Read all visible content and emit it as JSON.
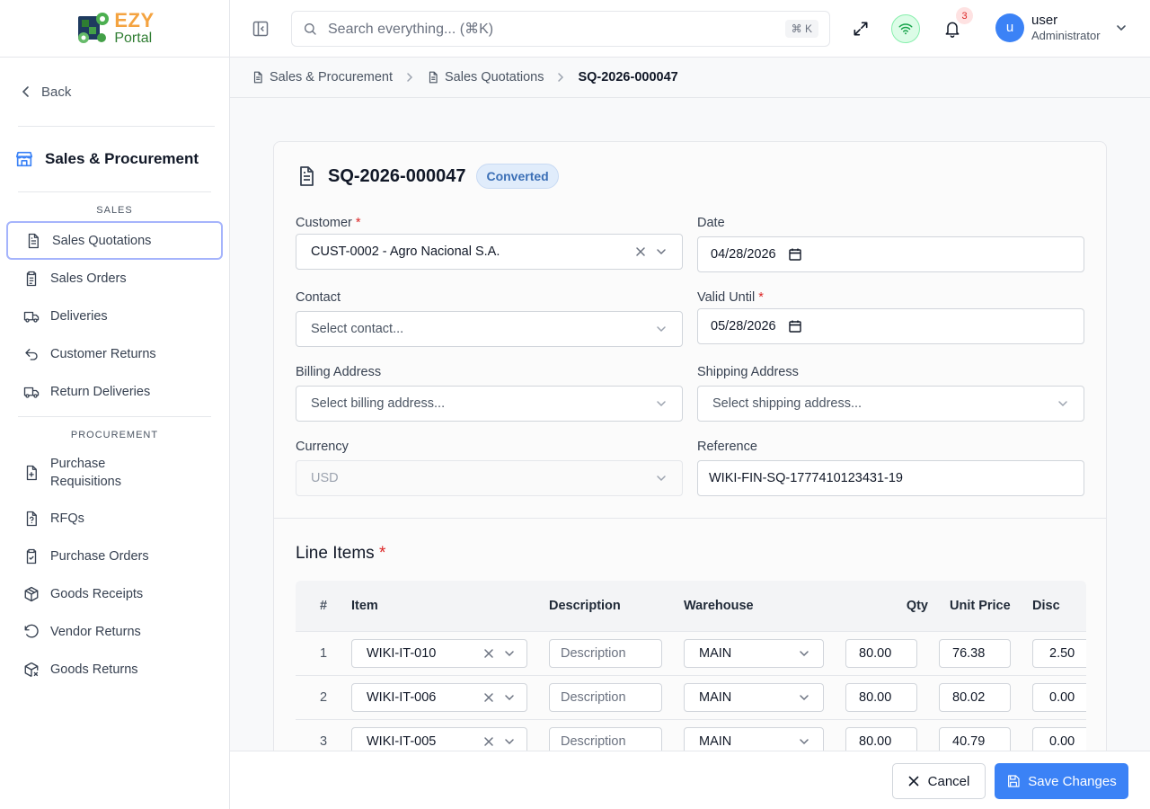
{
  "app": {
    "logo_top": "EZY",
    "logo_bottom": "Portal"
  },
  "sidebar": {
    "back_label": "Back",
    "module_title": "Sales & Procurement",
    "sales_section": "SALES",
    "procurement_section": "PROCUREMENT",
    "sales_items": [
      {
        "label": "Sales Quotations",
        "icon": "file-text-icon",
        "active": true
      },
      {
        "label": "Sales Orders",
        "icon": "clipboard-list-icon"
      },
      {
        "label": "Deliveries",
        "icon": "truck-icon"
      },
      {
        "label": "Customer Returns",
        "icon": "undo-arrow-icon"
      },
      {
        "label": "Return Deliveries",
        "icon": "truck-icon"
      }
    ],
    "procurement_items": [
      {
        "label": "Purchase Requisitions",
        "icon": "file-plus-icon"
      },
      {
        "label": "RFQs",
        "icon": "file-question-icon"
      },
      {
        "label": "Purchase Orders",
        "icon": "clipboard-check-icon"
      },
      {
        "label": "Goods Receipts",
        "icon": "package-icon"
      },
      {
        "label": "Vendor Returns",
        "icon": "rotate-ccw-icon"
      },
      {
        "label": "Goods Returns",
        "icon": "package-x-icon"
      }
    ]
  },
  "topbar": {
    "search_placeholder": "Search everything... (⌘K)",
    "search_shortcut": "⌘ K",
    "notification_count": "3",
    "user_initial": "u",
    "user_name": "user",
    "user_role": "Administrator"
  },
  "breadcrumb": {
    "items": [
      "Sales & Procurement",
      "Sales Quotations",
      "SQ-2026-000047"
    ]
  },
  "document": {
    "number": "SQ-2026-000047",
    "status": "Converted",
    "labels": {
      "customer": "Customer",
      "date": "Date",
      "contact": "Contact",
      "valid_until": "Valid Until",
      "billing_address": "Billing Address",
      "shipping_address": "Shipping Address",
      "currency": "Currency",
      "reference": "Reference",
      "required_mark": "*"
    },
    "values": {
      "customer": "CUST-0002 - Agro Nacional S.A.",
      "date": "04/28/2026",
      "contact_placeholder": "Select contact...",
      "valid_until": "05/28/2026",
      "billing_placeholder": "Select billing address...",
      "shipping_placeholder": "Select shipping address...",
      "currency": "USD",
      "reference": "WIKI-FIN-SQ-1777410123431-19"
    }
  },
  "line_items": {
    "title": "Line Items",
    "columns": [
      "#",
      "Item",
      "Description",
      "Warehouse",
      "Qty",
      "Unit Price",
      "Disc"
    ],
    "description_placeholder": "Description",
    "rows": [
      {
        "num": "1",
        "item": "WIKI-IT-010",
        "warehouse": "MAIN",
        "qty": "80.00",
        "unit_price": "76.38",
        "disc": "2.50"
      },
      {
        "num": "2",
        "item": "WIKI-IT-006",
        "warehouse": "MAIN",
        "qty": "80.00",
        "unit_price": "80.02",
        "disc": "0.00"
      },
      {
        "num": "3",
        "item": "WIKI-IT-005",
        "warehouse": "MAIN",
        "qty": "80.00",
        "unit_price": "40.79",
        "disc": "0.00"
      }
    ]
  },
  "footer": {
    "cancel_label": "Cancel",
    "save_label": "Save Changes"
  },
  "colors": {
    "primary": "#3b82f6",
    "badge_bg": "#e0ecfb",
    "danger": "#dc2626",
    "logo_orange": "#f4a340",
    "logo_green": "#2f7d32"
  }
}
